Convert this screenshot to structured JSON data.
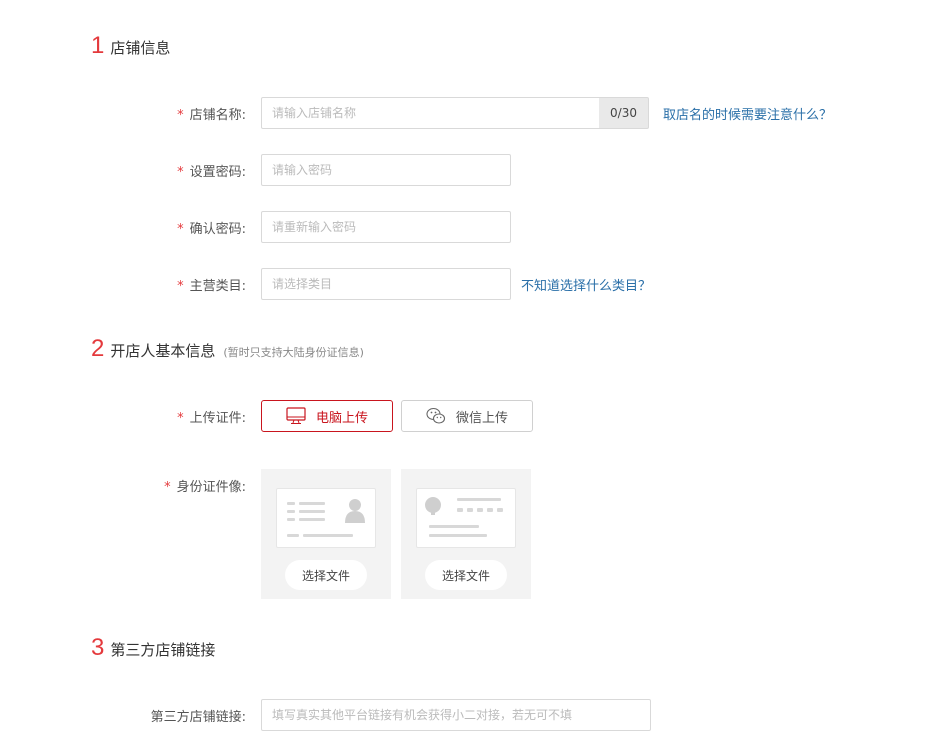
{
  "sections": {
    "store_info": {
      "number": "1",
      "title": "店铺信息"
    },
    "owner_info": {
      "number": "2",
      "title": "开店人基本信息",
      "note": "(暂时只支持大陆身份证信息)"
    },
    "third_party": {
      "number": "3",
      "title": "第三方店铺链接"
    }
  },
  "required_mark": "*",
  "store_name": {
    "label": "店铺名称:",
    "placeholder": "请输入店铺名称",
    "counter": "0/30",
    "help": "取店名的时候需要注意什么？"
  },
  "password": {
    "label": "设置密码:",
    "placeholder": "请输入密码"
  },
  "confirm_password": {
    "label": "确认密码:",
    "placeholder": "请重新输入密码"
  },
  "category": {
    "label": "主营类目:",
    "placeholder": "请选择类目",
    "help": "不知道选择什么类目？"
  },
  "upload_cert": {
    "label": "上传证件:",
    "pc_upload": "电脑上传",
    "wechat_upload": "微信上传"
  },
  "id_photo": {
    "label": "身份证件像:",
    "front_choose": "选择文件",
    "back_choose": "选择文件"
  },
  "third_party_link": {
    "label": "第三方店铺链接:",
    "placeholder": "填写真实其他平台链接有机会获得小二对接，若无可不填"
  },
  "colors": {
    "accent": "#e4393c",
    "link": "#2a6fa8",
    "active_border": "#c9151e"
  }
}
